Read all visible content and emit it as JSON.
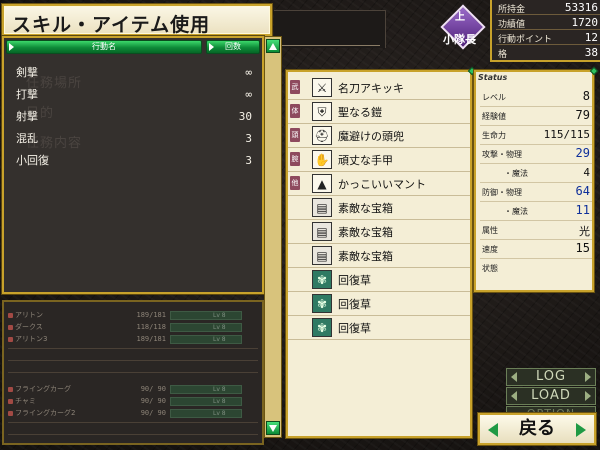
{
  "window": {
    "title": "スキル・アイテム使用"
  },
  "left_panel": {
    "header": {
      "col_action": "行動名",
      "col_count": "回数"
    },
    "skills": [
      {
        "name": "剣撃",
        "count": "∞"
      },
      {
        "name": "打撃",
        "count": "∞"
      },
      {
        "name": "射撃",
        "count": "30"
      },
      {
        "name": "混乱",
        "count": "3"
      },
      {
        "name": "小回復",
        "count": "3"
      }
    ],
    "ghost_text": {
      "location": "任務場所",
      "goal": "目的",
      "content": "任務内容"
    }
  },
  "party": [
    {
      "name": "アリトン",
      "hp": "189/181",
      "lv": "Lv 8"
    },
    {
      "name": "ダークス",
      "hp": "118/118",
      "lv": "Lv 8"
    },
    {
      "name": "アリトン3",
      "hp": "189/181",
      "lv": "Lv 8"
    },
    {
      "name": "フライングカーグ",
      "hp": "90/ 90",
      "lv": "Lv 8"
    },
    {
      "name": "チャミ",
      "hp": "90/ 90",
      "lv": "Lv 8"
    },
    {
      "name": "フライングカーグ2",
      "hp": "90/ 90",
      "lv": "Lv 8"
    }
  ],
  "items": [
    {
      "tag": "武",
      "icon": "sword-icon",
      "glyph": "⚔",
      "name": "名刀アキッキ",
      "kind": "equip"
    },
    {
      "tag": "体",
      "icon": "armor-icon",
      "glyph": "⛨",
      "name": "聖なる鎧",
      "kind": "equip"
    },
    {
      "tag": "頭",
      "icon": "helmet-icon",
      "glyph": "⛑",
      "name": "魔避けの頭兜",
      "kind": "equip"
    },
    {
      "tag": "腕",
      "icon": "gauntlet-icon",
      "glyph": "✋",
      "name": "頑丈な手甲",
      "kind": "equip"
    },
    {
      "tag": "他",
      "icon": "cloak-icon",
      "glyph": "▲",
      "name": "かっこいいマント",
      "kind": "equip"
    },
    {
      "tag": "",
      "icon": "treasure-chest-icon",
      "glyph": "▤",
      "name": "素敵な宝箱",
      "kind": "chest"
    },
    {
      "tag": "",
      "icon": "treasure-chest-icon",
      "glyph": "▤",
      "name": "素敵な宝箱",
      "kind": "chest"
    },
    {
      "tag": "",
      "icon": "treasure-chest-icon",
      "glyph": "▤",
      "name": "素敵な宝箱",
      "kind": "chest"
    },
    {
      "tag": "",
      "icon": "herb-icon",
      "glyph": "✾",
      "name": "回復草",
      "kind": "herb"
    },
    {
      "tag": "",
      "icon": "herb-icon",
      "glyph": "✾",
      "name": "回復草",
      "kind": "herb"
    },
    {
      "tag": "",
      "icon": "herb-icon",
      "glyph": "✾",
      "name": "回復草",
      "kind": "herb"
    }
  ],
  "status": {
    "label": "Status",
    "rows": [
      {
        "label": "レベル",
        "value": "8",
        "style": "normal"
      },
      {
        "label": "経験値",
        "value": "79",
        "style": "normal"
      },
      {
        "label": "生命力",
        "value": "115/115",
        "style": "normal"
      },
      {
        "label": "攻撃・物理",
        "value": "29",
        "style": "num"
      },
      {
        "label": "・魔法",
        "value": "4",
        "style": "small"
      },
      {
        "label": "防御・物理",
        "value": "64",
        "style": "num"
      },
      {
        "label": "・魔法",
        "value": "11",
        "style": "num"
      },
      {
        "label": "属性",
        "value": "光",
        "style": "small"
      },
      {
        "label": "速度",
        "value": "15",
        "style": "normal"
      },
      {
        "label": "状態",
        "value": "",
        "style": "small"
      }
    ]
  },
  "rank": {
    "top": "上",
    "name": "小隊長"
  },
  "info": [
    {
      "label": "所持金",
      "value": "53316"
    },
    {
      "label": "功績値",
      "value": "1720"
    },
    {
      "label": "行動ポイント",
      "value": "12"
    },
    {
      "label": "格",
      "value": "38"
    }
  ],
  "buttons": {
    "log": "LOG",
    "load": "LOAD",
    "option": "OPTION",
    "back": "戻る"
  },
  "colors": {
    "gold_border": "#c8a22b",
    "header_green": "#0d8a38",
    "panel_cream": "#f4eed6",
    "dark_panel": "#34302d",
    "blue_value": "#0e2f9a",
    "rank_purple": "#6a3a9a"
  }
}
